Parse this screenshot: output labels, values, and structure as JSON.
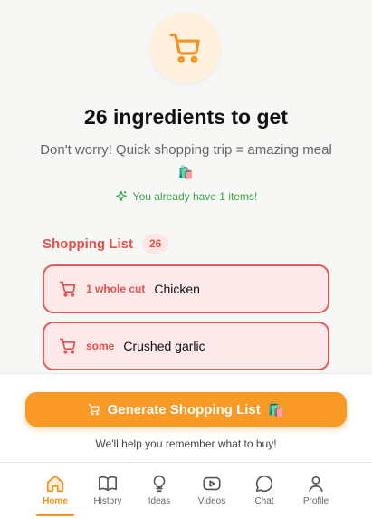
{
  "header": {
    "cart_icon": "shopping-cart-icon",
    "title": "26 ingredients to get",
    "subtitle": "Don't worry! Quick shopping trip = amazing meal",
    "subtitle_emoji": "🛍️",
    "have_note": "You already have 1 items!",
    "have_icon": "sparkle-icon"
  },
  "shopping_list": {
    "title": "Shopping List",
    "count": "26",
    "items": [
      {
        "qty": "1 whole cut",
        "name": "Chicken"
      },
      {
        "qty": "some",
        "name": "Crushed garlic"
      }
    ]
  },
  "actions": {
    "generate_label": "Generate Shopping List",
    "generate_emoji": "🛍️",
    "helper_text": "We'll help you remember what to buy!"
  },
  "tabs": [
    {
      "label": "Home",
      "icon": "home-icon",
      "active": true
    },
    {
      "label": "History",
      "icon": "book-icon",
      "active": false
    },
    {
      "label": "Ideas",
      "icon": "lightbulb-icon",
      "active": false
    },
    {
      "label": "Videos",
      "icon": "play-icon",
      "active": false
    },
    {
      "label": "Chat",
      "icon": "chat-bubble-icon",
      "active": false
    },
    {
      "label": "Profile",
      "icon": "person-icon",
      "active": false
    }
  ],
  "colors": {
    "accent": "#f99a27",
    "list_red": "#e6504a",
    "success": "#3aa54a"
  }
}
